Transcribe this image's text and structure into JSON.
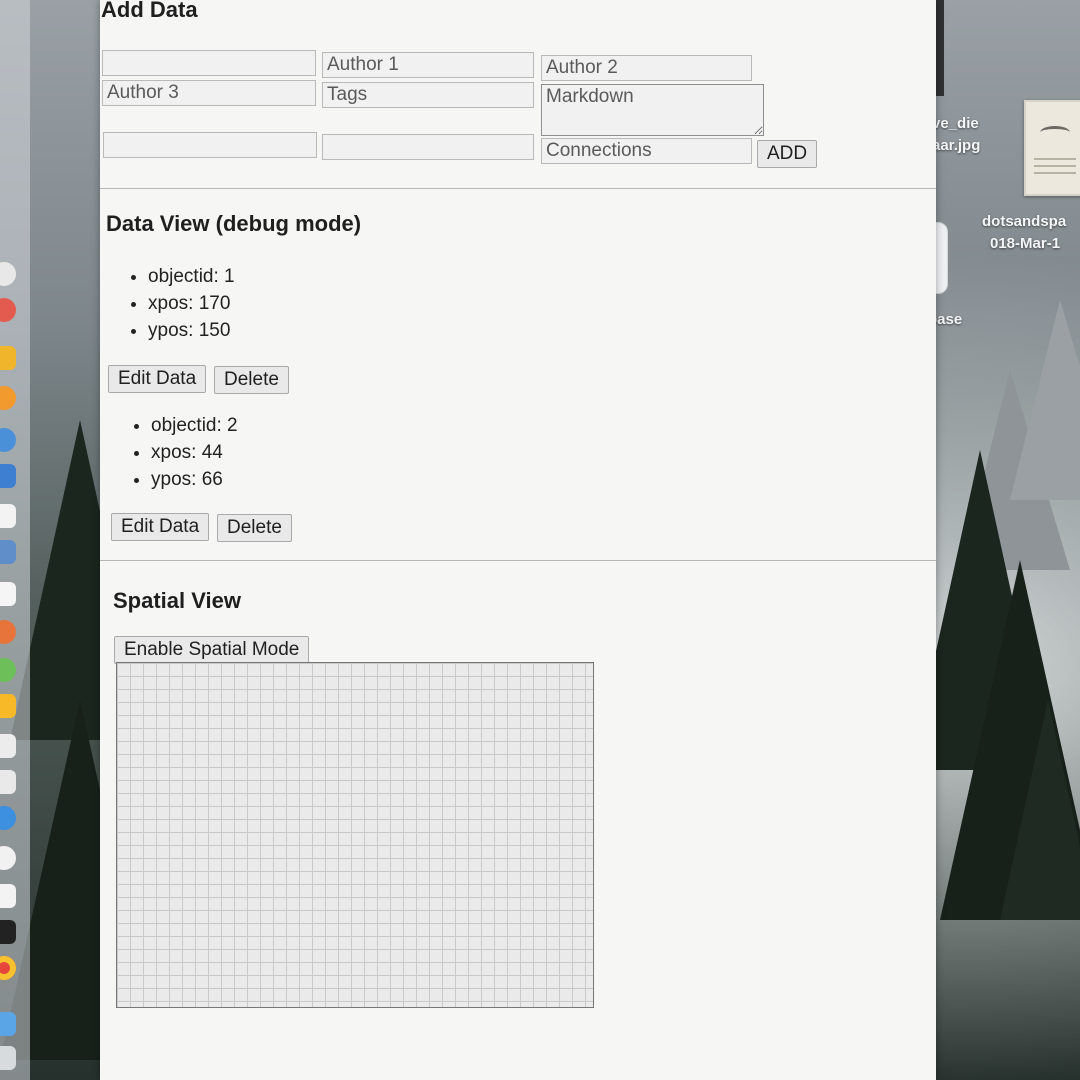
{
  "add_data": {
    "title": "Add Data",
    "fields": {
      "field_1": "",
      "author_1": "Author 1",
      "author_2": "Author 2",
      "author_3": "Author 3",
      "tags": "Tags",
      "markdown": "Markdown",
      "field_7": "",
      "field_8": "",
      "connections": "Connections"
    },
    "add_label": "ADD"
  },
  "data_view": {
    "title": "Data View (debug mode)",
    "records": [
      {
        "objectid": "objectid: 1",
        "xpos": "xpos: 170",
        "ypos": "ypos: 150",
        "edit_label": "Edit Data",
        "delete_label": "Delete"
      },
      {
        "objectid": "objectid: 2",
        "xpos": "xpos: 44",
        "ypos": "ypos: 66",
        "edit_label": "Edit Data",
        "delete_label": "Delete"
      }
    ]
  },
  "spatial_view": {
    "title": "Spatial View",
    "enable_label": "Enable Spatial Mode"
  },
  "desktop": {
    "file_label_1": "ve_die",
    "file_label_2": "aar.jpg",
    "file_label_3": "dotsandspa",
    "file_label_4": "018-Mar-1",
    "file_label_5": "base"
  },
  "colors": {
    "page_background": "#f6f6f5",
    "button_background": "#e9e9e9",
    "grid_line": "#c9c9c9"
  }
}
